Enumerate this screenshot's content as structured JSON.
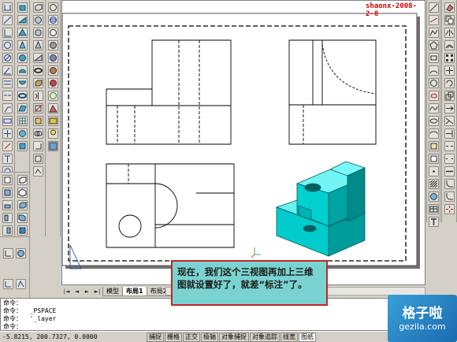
{
  "watermark": {
    "author_date": "shaonx-2008-2-8"
  },
  "tabs": {
    "nav_first": "|◄",
    "nav_prev": "◄",
    "nav_next": "►",
    "nav_last": "►|",
    "items": [
      "模型",
      "布局1",
      "布局2"
    ]
  },
  "callout": {
    "text": "现在，我们这个三视图再加上三维图就设置好了，就差“标注”了。"
  },
  "command": {
    "lines": [
      "命令：",
      "命令：  _PSPACE",
      "命令：  '_layer",
      "命令："
    ]
  },
  "status": {
    "coordinates": "-5.8215,  200.7327, 0.0000",
    "buttons": [
      "捕捉",
      "栅格",
      "正交",
      "极轴",
      "对象捕捉",
      "对象追踪",
      "线宽",
      "图纸"
    ],
    "active_buttons": [
      "图纸"
    ]
  },
  "logo": {
    "name_cn": "格子啦",
    "name_en": "gezila.com"
  },
  "colors": {
    "model_fill": "#00d2d2",
    "callout_border": "#c82424",
    "callout_bg": "#7ad3d0",
    "watermark": "#d00000"
  }
}
